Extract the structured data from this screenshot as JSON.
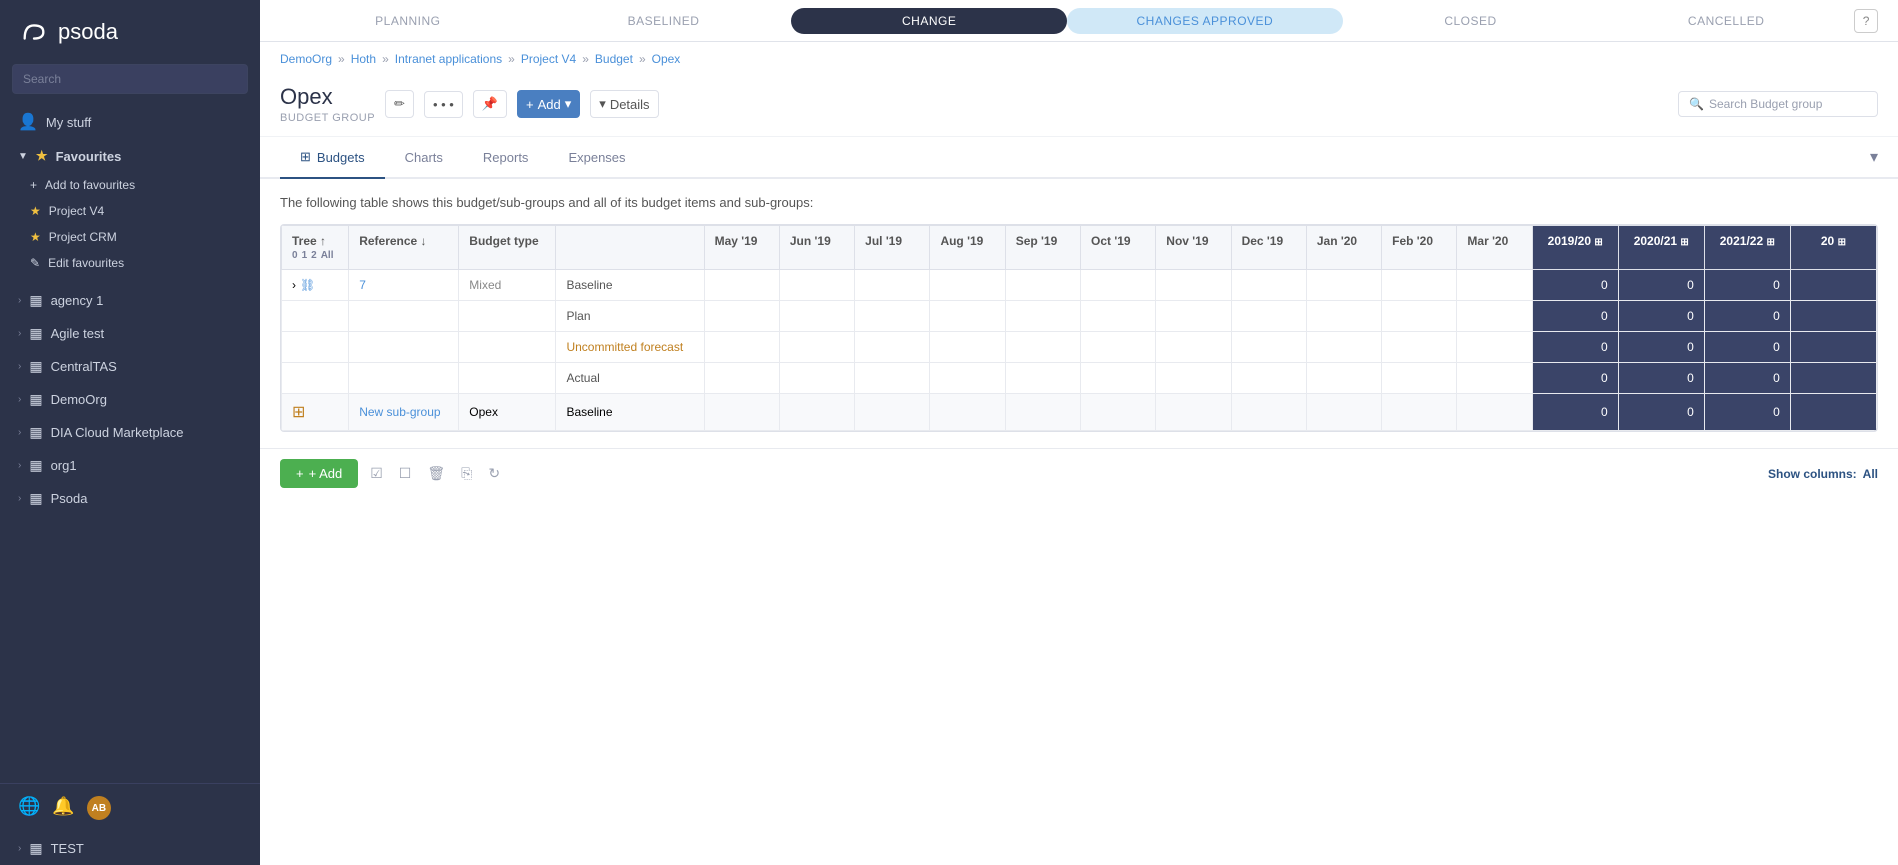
{
  "sidebar": {
    "logo_text": "psoda",
    "search_placeholder": "Search",
    "my_stuff": "My stuff",
    "favourites_label": "Favourites",
    "add_to_favourites": "Add to favourites",
    "fav_items": [
      "Project V4",
      "Project CRM"
    ],
    "edit_favourites": "Edit favourites",
    "orgs": [
      "agency 1",
      "Agile test",
      "CentralTAS",
      "DemoOrg",
      "DIA Cloud Marketplace",
      "org1",
      "Psoda",
      "TEST"
    ]
  },
  "status_bar": {
    "steps": [
      "PLANNING",
      "BASELINED",
      "CHANGE",
      "CHANGES APPROVED",
      "CLOSED",
      "CANCELLED"
    ],
    "active": "CHANGE",
    "approved": "CHANGES APPROVED",
    "help": "?"
  },
  "breadcrumb": {
    "items": [
      "DemoOrg",
      "Hoth",
      "Intranet applications",
      "Project V4",
      "Budget",
      "Opex"
    ]
  },
  "page": {
    "title": "Opex",
    "subtitle": "BUDGET GROUP",
    "search_placeholder": "Search Budget group"
  },
  "buttons": {
    "edit": "✏",
    "more": "•••",
    "pin": "📌",
    "add": "+ Add",
    "details": "Details"
  },
  "tabs": {
    "items": [
      "Budgets",
      "Charts",
      "Reports",
      "Expenses"
    ]
  },
  "table": {
    "description": "The following table shows this budget/sub-groups and all of its budget items and sub-groups:",
    "headers": {
      "tree": "Tree",
      "reference": "Reference",
      "budget_type": "Budget type",
      "type": "",
      "months": [
        "May '19",
        "Jun '19",
        "Jul '19",
        "Aug '19",
        "Sep '19",
        "Oct '19",
        "Nov '19",
        "Dec '19",
        "Jan '20",
        "Feb '20",
        "Mar '20"
      ],
      "years": [
        "2019/20",
        "2020/21",
        "2021/22",
        "20"
      ]
    },
    "tree_filters": [
      "0",
      "1",
      "2",
      "All"
    ],
    "rows": [
      {
        "id": "row1",
        "expand": true,
        "ref": "7",
        "budget_type": "Mixed",
        "type": "Baseline",
        "months": [
          "",
          "",
          "",
          "",
          "",
          "",
          "",
          "",
          "",
          "",
          ""
        ],
        "years": [
          "0",
          "0",
          "0",
          ""
        ]
      },
      {
        "id": "row2",
        "expand": false,
        "ref": "",
        "budget_type": "",
        "type": "Plan",
        "months": [
          "",
          "",
          "",
          "",
          "",
          "",
          "",
          "",
          "",
          "",
          ""
        ],
        "years": [
          "0",
          "0",
          "0",
          ""
        ]
      },
      {
        "id": "row3",
        "expand": false,
        "ref": "",
        "budget_type": "",
        "type": "Uncommitted forecast",
        "months": [
          "",
          "",
          "",
          "",
          "",
          "",
          "",
          "",
          "",
          "",
          ""
        ],
        "years": [
          "0",
          "0",
          "0",
          ""
        ]
      },
      {
        "id": "row4",
        "expand": false,
        "ref": "",
        "budget_type": "",
        "type": "Actual",
        "months": [
          "",
          "",
          "",
          "",
          "",
          "",
          "",
          "",
          "",
          "",
          ""
        ],
        "years": [
          "0",
          "0",
          "0",
          ""
        ]
      },
      {
        "id": "row5",
        "is_sub": true,
        "ref": "New sub-group",
        "budget_type": "Opex",
        "type": "Baseline",
        "months": [
          "",
          "",
          "",
          "",
          "",
          "",
          "",
          "",
          "",
          "",
          ""
        ],
        "years": [
          "0",
          "0",
          "0",
          ""
        ]
      }
    ]
  },
  "footer": {
    "add_label": "+ Add",
    "show_columns_label": "Show columns:",
    "show_columns_value": "All"
  }
}
